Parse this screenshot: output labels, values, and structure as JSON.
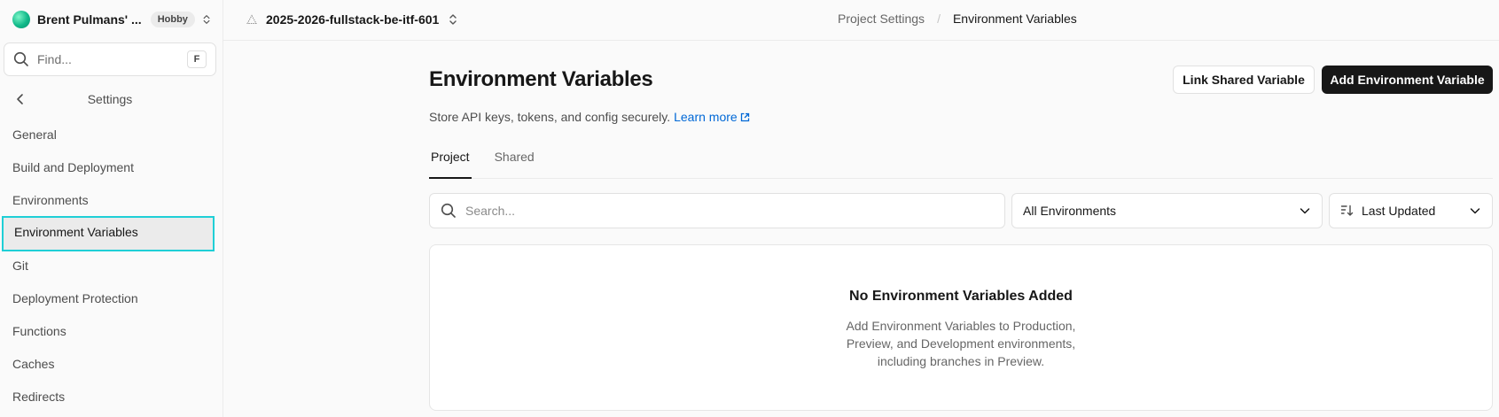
{
  "team": {
    "name": "Brent Pulmans' ...",
    "plan": "Hobby"
  },
  "find": {
    "placeholder": "Find...",
    "shortcut": "F"
  },
  "sidebar": {
    "title": "Settings",
    "items": [
      {
        "label": "General"
      },
      {
        "label": "Build and Deployment"
      },
      {
        "label": "Environments"
      },
      {
        "label": "Environment Variables",
        "active": true
      },
      {
        "label": "Git"
      },
      {
        "label": "Deployment Protection"
      },
      {
        "label": "Functions"
      },
      {
        "label": "Caches"
      },
      {
        "label": "Redirects"
      }
    ]
  },
  "topbar": {
    "project_name": "2025-2026-fullstack-be-itf-601",
    "breadcrumb": [
      "Project Settings",
      "Environment Variables"
    ]
  },
  "main": {
    "title": "Environment Variables",
    "link_shared_label": "Link Shared Variable",
    "add_label": "Add Environment Variable",
    "subtitle": "Store API keys, tokens, and config securely.",
    "learn_more": "Learn more",
    "tabs": [
      {
        "label": "Project",
        "active": true
      },
      {
        "label": "Shared"
      }
    ],
    "search_placeholder": "Search...",
    "environment_filter": "All Environments",
    "sort": "Last Updated",
    "empty": {
      "title": "No Environment Variables Added",
      "description": "Add Environment Variables to Production, Preview, and Development environments, including branches in Preview."
    }
  },
  "colors": {
    "accent_highlight": "#1fcfd6",
    "primary_button": "#171717",
    "link": "#0068d6"
  }
}
